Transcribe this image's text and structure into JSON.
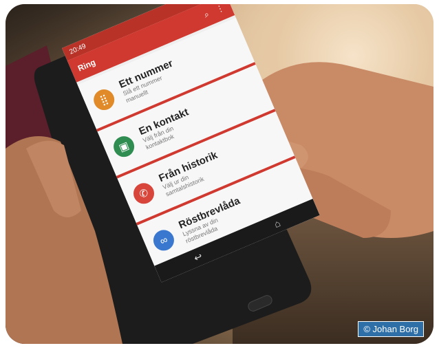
{
  "phone": {
    "time": "20:49",
    "app_title": "Ring",
    "icons": {
      "search": "search-icon",
      "menu": "more-vert-icon"
    },
    "items": [
      {
        "title": "Ett nummer",
        "subtitle": "Slå ett nummer manuellt",
        "icon": "keypad-icon",
        "color": "#e08a2a"
      },
      {
        "title": "En kontakt",
        "subtitle": "Välj från din kontaktbok",
        "icon": "contact-book-icon",
        "color": "#2f8d52"
      },
      {
        "title": "Från historik",
        "subtitle": "Välj ur din samtalshistorik",
        "icon": "call-history-icon",
        "color": "#d8453b"
      },
      {
        "title": "Röstbrevlåda",
        "subtitle": "Lyssna av din röstbrevlåda",
        "icon": "voicemail-icon",
        "color": "#3a78d0"
      }
    ],
    "nav": {
      "back": "back-icon",
      "home": "home-icon"
    }
  },
  "credit": "© Johan Borg",
  "colors": {
    "accent": "#d0392f",
    "credit_bg": "#2f6fa8"
  }
}
